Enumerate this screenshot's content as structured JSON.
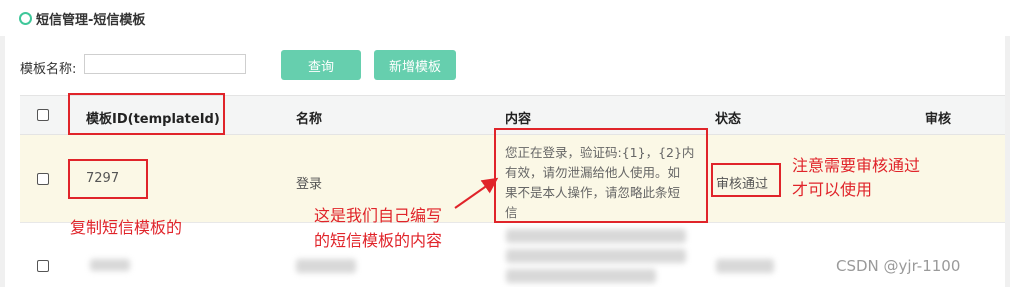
{
  "header": {
    "title": "短信管理-短信模板"
  },
  "search": {
    "label": "模板名称:",
    "placeholder": "",
    "value": ""
  },
  "buttons": {
    "query": "查询",
    "add_template": "新增模板"
  },
  "table": {
    "columns": [
      "模板ID(templateId)",
      "名称",
      "内容",
      "状态",
      "审核"
    ],
    "rows": [
      {
        "template_id": "7297",
        "name": "登录",
        "content_lines": [
          "您正在登录，验证码:{1}，{2}内",
          "有效，请勿泄漏给他人使用。如",
          "果不是本人操作，请忽略此条短",
          "信"
        ],
        "status": "审核通过"
      }
    ]
  },
  "annotations": {
    "copy_template": "复制短信模板的",
    "own_content_line1": "这是我们自己编写",
    "own_content_line2": "的短信模板的内容",
    "review_note_line1": "注意需要审核通过",
    "review_note_line2": "才可以使用",
    "color": "#e0242a"
  },
  "watermark": "CSDN @yjr-1100"
}
